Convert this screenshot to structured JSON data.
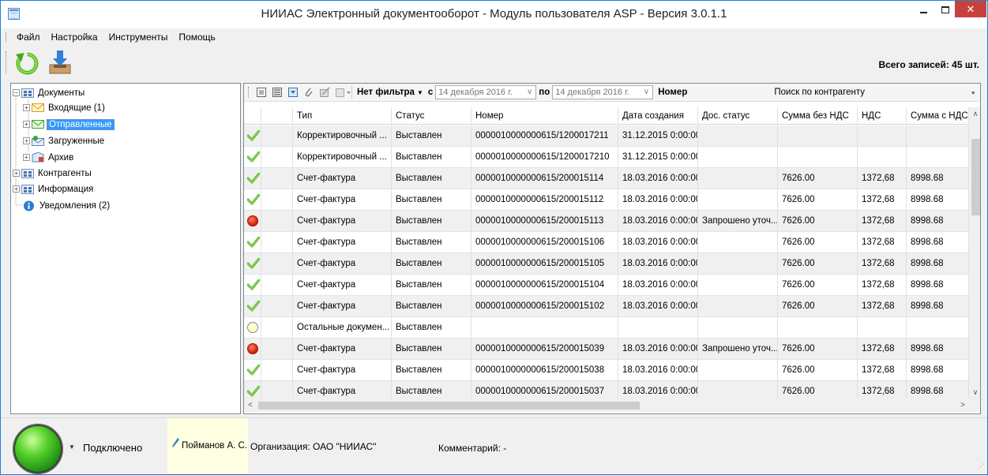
{
  "window": {
    "title": "НИИАС Электронный документооборот - Модуль пользователя ASP - Версия 3.0.1.1",
    "min": "–",
    "close": "✕"
  },
  "menu": [
    "Файл",
    "Настройка",
    "Инструменты",
    "Помощь"
  ],
  "toolbar": {
    "refresh_icon": "refresh-icon",
    "download_icon": "download-inbox-icon",
    "total_records": "Всего записей: 45 шт."
  },
  "tree": [
    {
      "label": "Документы",
      "icon": "folder-grid-icon",
      "expander": "−"
    },
    {
      "label": "Входящие (1)",
      "icon": "envelope-in-icon",
      "expander": "+"
    },
    {
      "label": "Отправленные",
      "icon": "envelope-out-icon",
      "expander": "+"
    },
    {
      "label": "Загруженные",
      "icon": "envelope-loaded-icon",
      "expander": "+"
    },
    {
      "label": "Архив",
      "icon": "archive-icon",
      "expander": "+"
    },
    {
      "label": "Контрагенты",
      "icon": "folder-grid-icon",
      "expander": "+"
    },
    {
      "label": "Информация",
      "icon": "folder-grid-icon",
      "expander": "+"
    },
    {
      "label": "Уведомления (2)",
      "icon": "info-icon",
      "expander": ""
    }
  ],
  "filter_bar": {
    "filter_value": "Нет фильтра",
    "from_label": "с",
    "date_from": "14 декабря  2016 г.",
    "to_label": "по",
    "date_to": "14 декабря  2016 г.",
    "number_label": "Номер",
    "contractor_search": "Поиск по контрагенту"
  },
  "grid": {
    "columns": [
      "",
      "",
      "Тип",
      "Статус",
      "Номер",
      "Дата создания",
      "Дос. статус",
      "Сумма без НДС",
      "НДС",
      "Сумма с НДС"
    ],
    "rows": [
      {
        "icon": "check",
        "type": "Корректировочный ...",
        "status": "Выставлен",
        "number": "0000010000000615/1200017211",
        "date": "31.12.2015 0:00:00",
        "doc_status": "",
        "sum_no_vat": "",
        "vat": "",
        "sum_vat": ""
      },
      {
        "icon": "check",
        "type": "Корректировочный ...",
        "status": "Выставлен",
        "number": "0000010000000615/1200017210",
        "date": "31.12.2015 0:00:00",
        "doc_status": "",
        "sum_no_vat": "",
        "vat": "",
        "sum_vat": ""
      },
      {
        "icon": "check",
        "type": "Счет-фактура",
        "status": "Выставлен",
        "number": "0000010000000615/200015114",
        "date": "18.03.2016 0:00:00",
        "doc_status": "",
        "sum_no_vat": "7626.00",
        "vat": "1372,68",
        "sum_vat": "8998.68"
      },
      {
        "icon": "check",
        "type": "Счет-фактура",
        "status": "Выставлен",
        "number": "0000010000000615/200015112",
        "date": "18.03.2016 0:00:00",
        "doc_status": "",
        "sum_no_vat": "7626.00",
        "vat": "1372,68",
        "sum_vat": "8998.68"
      },
      {
        "icon": "red",
        "type": "Счет-фактура",
        "status": "Выставлен",
        "number": "0000010000000615/200015113",
        "date": "18.03.2016 0:00:00",
        "doc_status": "Запрошено уточ...",
        "sum_no_vat": "7626.00",
        "vat": "1372,68",
        "sum_vat": "8998.68"
      },
      {
        "icon": "check",
        "type": "Счет-фактура",
        "status": "Выставлен",
        "number": "0000010000000615/200015106",
        "date": "18.03.2016 0:00:00",
        "doc_status": "",
        "sum_no_vat": "7626.00",
        "vat": "1372,68",
        "sum_vat": "8998.68"
      },
      {
        "icon": "check",
        "type": "Счет-фактура",
        "status": "Выставлен",
        "number": "0000010000000615/200015105",
        "date": "18.03.2016 0:00:00",
        "doc_status": "",
        "sum_no_vat": "7626.00",
        "vat": "1372,68",
        "sum_vat": "8998.68"
      },
      {
        "icon": "check",
        "type": "Счет-фактура",
        "status": "Выставлен",
        "number": "0000010000000615/200015104",
        "date": "18.03.2016 0:00:00",
        "doc_status": "",
        "sum_no_vat": "7626.00",
        "vat": "1372,68",
        "sum_vat": "8998.68"
      },
      {
        "icon": "check",
        "type": "Счет-фактура",
        "status": "Выставлен",
        "number": "0000010000000615/200015102",
        "date": "18.03.2016 0:00:00",
        "doc_status": "",
        "sum_no_vat": "7626.00",
        "vat": "1372,68",
        "sum_vat": "8998.68"
      },
      {
        "icon": "yellow",
        "type": "Остальные докумен...",
        "status": "Выставлен",
        "number": "",
        "date": "",
        "doc_status": "",
        "sum_no_vat": "",
        "vat": "",
        "sum_vat": ""
      },
      {
        "icon": "red",
        "type": "Счет-фактура",
        "status": "Выставлен",
        "number": "0000010000000615/200015039",
        "date": "18.03.2016 0:00:00",
        "doc_status": "Запрошено уточ...",
        "sum_no_vat": "7626.00",
        "vat": "1372,68",
        "sum_vat": "8998.68"
      },
      {
        "icon": "check",
        "type": "Счет-фактура",
        "status": "Выставлен",
        "number": "0000010000000615/200015038",
        "date": "18.03.2016 0:00:00",
        "doc_status": "",
        "sum_no_vat": "7626.00",
        "vat": "1372,68",
        "sum_vat": "8998.68"
      },
      {
        "icon": "check",
        "type": "Счет-фактура",
        "status": "Выставлен",
        "number": "0000010000000615/200015037",
        "date": "18.03.2016 0:00:00",
        "doc_status": "",
        "sum_no_vat": "7626.00",
        "vat": "1372,68",
        "sum_vat": "8998.68"
      }
    ]
  },
  "statusbar": {
    "connection": "Подключено",
    "user": "Пойманов А. С.",
    "organization": "Организация:  ОАО \"НИИАС\"",
    "comment": "Комментарий:  -"
  },
  "colors": {
    "selection": "#3399ff",
    "close_button": "#c7413c",
    "connected_light": "#55d02b",
    "user_box": "#ffffe1"
  }
}
